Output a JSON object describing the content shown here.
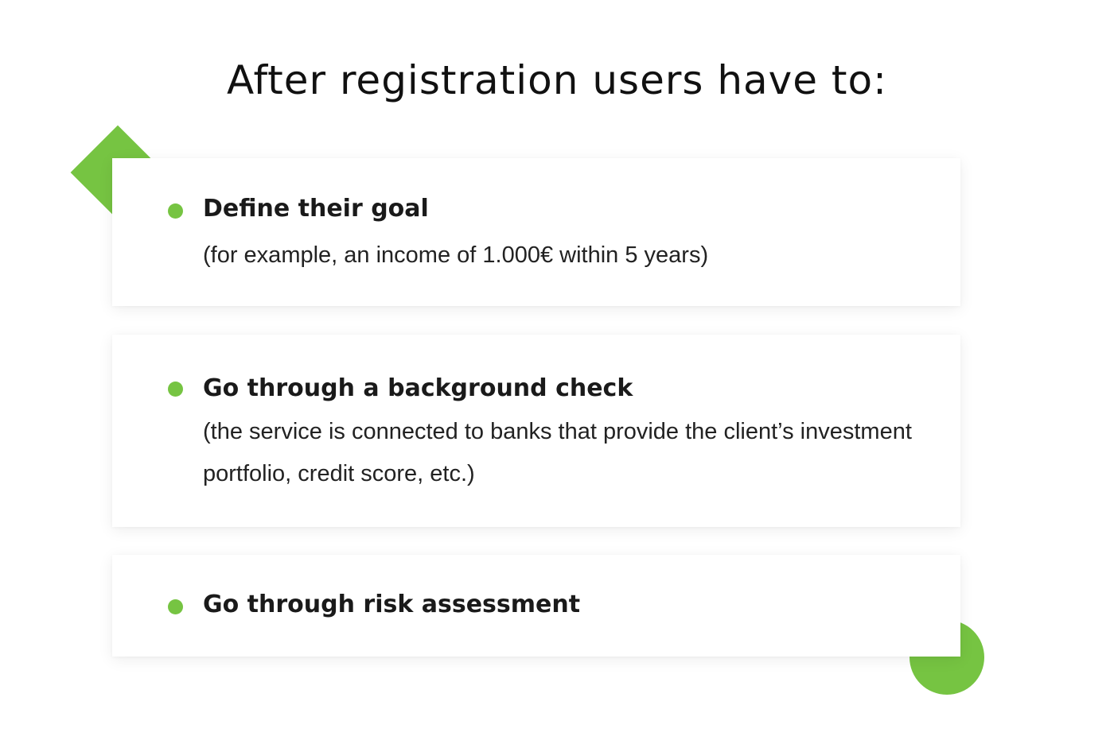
{
  "heading": "After registration users have to:",
  "items": [
    {
      "title": "Define their goal",
      "description": "(for example, an income of 1.000€ within 5 years)"
    },
    {
      "title": "Go through a background check",
      "description": "(the service is connected to banks that provide the client’s investment portfolio, credit score, etc.)"
    },
    {
      "title": "Go through risk assessment"
    }
  ],
  "colors": {
    "accent": "#76c442",
    "text": "#1a1a1a",
    "background": "#ffffff"
  },
  "icons": {
    "bullet": "circle-bullet-icon",
    "decor_top_left": "diamond-shape-icon",
    "decor_bottom_right": "circle-shape-icon"
  }
}
